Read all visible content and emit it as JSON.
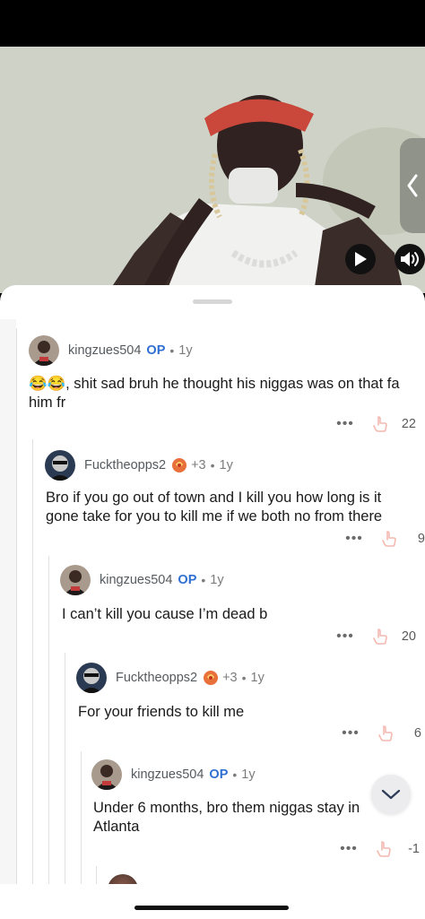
{
  "video": {
    "side_handle_icon": "chevron-left-icon",
    "play_icon": "play-icon",
    "volume_icon": "volume-icon"
  },
  "comments": [
    {
      "username": "kingzues504",
      "op_label": "OP",
      "age": "1y",
      "emoji": "😂😂",
      "body": ", shit sad bruh he thought his niggas was on that fa him fr",
      "score": "22"
    },
    {
      "username": "Fucktheopps2",
      "flair_count": "+3",
      "age": "1y",
      "body": "Bro if you go out of town and I kill you how long is it gone take for you to kill me if we both no from there",
      "score": "9"
    },
    {
      "username": "kingzues504",
      "op_label": "OP",
      "age": "1y",
      "body": "I can’t kill you cause I’m dead b",
      "score": "20"
    },
    {
      "username": "Fucktheopps2",
      "flair_count": "+3",
      "age": "1y",
      "body": "For your friends to kill me",
      "score": "6"
    },
    {
      "username": "kingzues504",
      "op_label": "OP",
      "age": "1y",
      "body": "Under 6 months, bro them niggas stay in Atlanta",
      "score": "-1"
    }
  ],
  "ui": {
    "more_label": "•••",
    "dot": "•",
    "scroll_down_icon": "chevron-down-icon"
  },
  "colors": {
    "op": "#2f6fd1",
    "meta": "#7c7c7c",
    "thread_line": "#e1e1e3"
  }
}
